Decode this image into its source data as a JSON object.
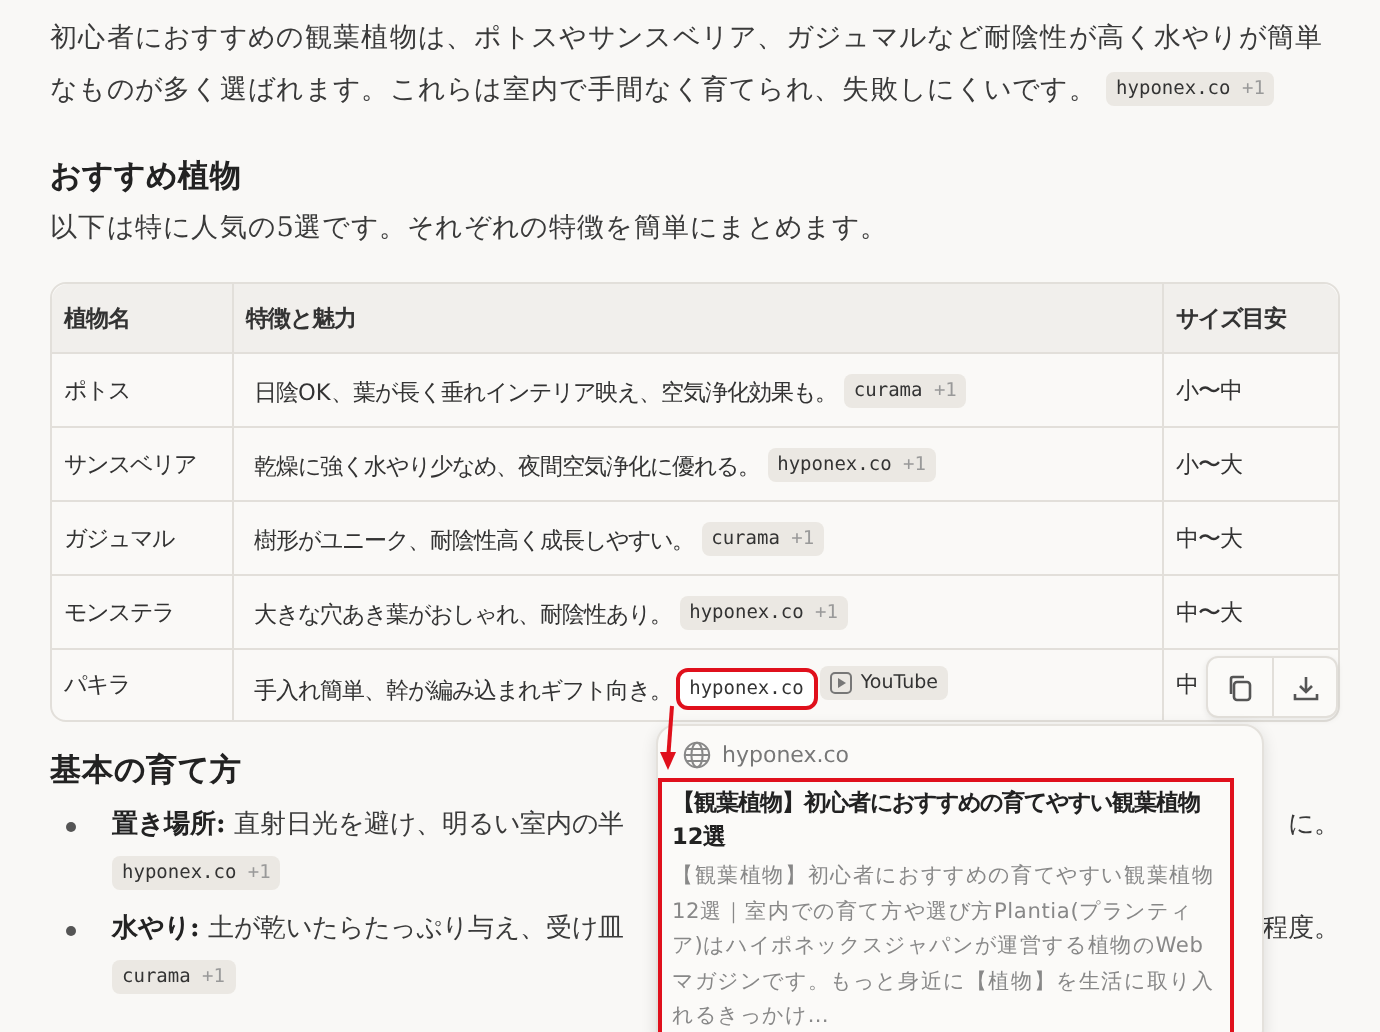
{
  "intro": {
    "text": "初心者におすすめの観葉植物は、ポトスやサンスベリア、ガジュマルなど耐陰性が高く水やりが簡単なものが多く選ばれます。これらは室内で手間なく育てられ、失敗しにくいです。",
    "chips": [
      {
        "kind": "source",
        "name": "hyponex.co",
        "extra": "+1",
        "highlighted": false
      }
    ]
  },
  "section1": {
    "heading": "おすすめ植物",
    "text": "以下は特に人気の5選です。それぞれの特徴を簡単にまとめます。"
  },
  "table": {
    "columns": [
      "植物名",
      "特徴と魅力",
      "サイズ目安"
    ],
    "rows": [
      {
        "name": "ポトス",
        "feature": "日陰OK、葉が長く垂れインテリア映え、空気浄化効果も。",
        "chips": [
          {
            "kind": "source",
            "name": "curama",
            "extra": "+1",
            "highlighted": false
          }
        ],
        "size": "小〜中"
      },
      {
        "name": "サンスベリア",
        "feature": "乾燥に強く水やり少なめ、夜間空気浄化に優れる。",
        "chips": [
          {
            "kind": "source",
            "name": "hyponex.co",
            "extra": "+1",
            "highlighted": false
          }
        ],
        "size": "小〜大"
      },
      {
        "name": "ガジュマル",
        "feature": "樹形がユニーク、耐陰性高く成長しやすい。",
        "chips": [
          {
            "kind": "source",
            "name": "curama",
            "extra": "+1",
            "highlighted": false
          }
        ],
        "size": "中〜大"
      },
      {
        "name": "モンステラ",
        "feature": "大きな穴あき葉がおしゃれ、耐陰性あり。",
        "chips": [
          {
            "kind": "source",
            "name": "hyponex.co",
            "extra": "+1",
            "highlighted": false
          }
        ],
        "size": "中〜大"
      },
      {
        "name": "パキラ",
        "feature": "手入れ簡単、幹が編み込まれギフト向き。",
        "chips": [
          {
            "kind": "source",
            "name": "hyponex.co",
            "highlighted": true
          },
          {
            "kind": "video",
            "name": "YouTube",
            "highlighted": false
          }
        ],
        "size": "中"
      }
    ]
  },
  "section2": {
    "heading": "基本の育て方",
    "items": [
      {
        "label": "置き場所:",
        "text_start": "直射日光を避け、明るい室内の半",
        "text_end": "に。",
        "chips": [
          {
            "kind": "source",
            "name": "hyponex.co",
            "extra": "+1",
            "highlighted": false
          }
        ]
      },
      {
        "label": "水やり:",
        "text_start": "土が乾いたらたっぷり与え、受け皿",
        "text_end": "程度。",
        "chips": [
          {
            "kind": "source",
            "name": "curama",
            "extra": "+1",
            "highlighted": false
          }
        ]
      }
    ]
  },
  "popover": {
    "site": "hyponex.co",
    "title": "【観葉植物】初心者におすすめの育てやすい観葉植物12選",
    "description": "【観葉植物】初心者におすすめの育てやすい観葉植物12選｜室内での育て方や選び方Plantia(プランティア)はハイポネックスジャパンが運営する植物のWebマガジンです。もっと身近に【植物】を生活に取り入れるきっかけ…",
    "highlighted": true
  }
}
